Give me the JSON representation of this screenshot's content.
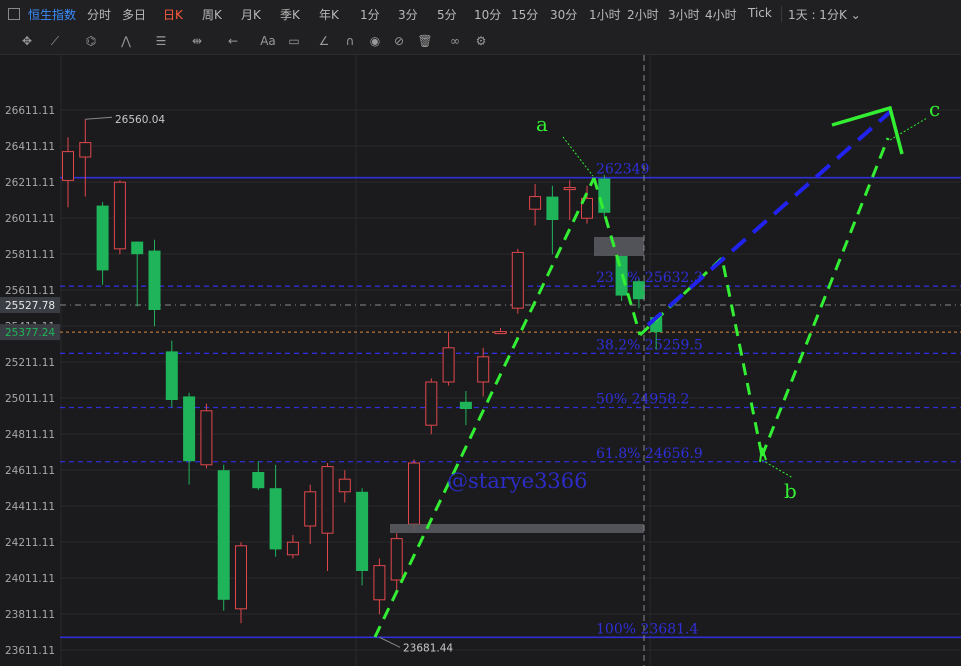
{
  "toolbar": {
    "index_tag": "恒生指数",
    "periods": [
      "分时",
      "多日",
      "日K",
      "周K",
      "月K",
      "季K",
      "年K",
      "1分",
      "3分",
      "5分",
      "10分",
      "15分",
      "30分",
      "1小时",
      "2小时",
      "3小时",
      "4小时",
      "Tick"
    ],
    "active_period": "日K",
    "range_select": "1天 : 1分K"
  },
  "tools": [
    "crosshair-icon",
    "line-tool-icon",
    "pattern-icon",
    "wave-tool-icon",
    "fib-tool-icon",
    "measure-tool-icon",
    "arrow-tool-icon",
    "text-tool-icon",
    "comment-tool-icon",
    "ruler-icon",
    "magnet-icon",
    "eye-icon",
    "hide-icon",
    "trash-icon",
    "link-icon",
    "settings-icon"
  ],
  "tool_glyphs": [
    "✥",
    "⟋",
    "⌬",
    "⋀",
    "☰",
    "⇹",
    "←",
    "Aa",
    "▭",
    "∠",
    "∩",
    "◉",
    "⊘",
    "🗑",
    "∞",
    "⚙"
  ],
  "colors": {
    "up": "#e0474c",
    "down": "#1fb45a",
    "fib": "#2f2fd8",
    "projection_green": "#33ee33",
    "projection_blue": "#2222ee",
    "price_tag_dark": "#3a3d43"
  },
  "chart_data": {
    "type": "candlestick",
    "y_ticks": [
      "26611.11",
      "26411.11",
      "26211.11",
      "26011.11",
      "25811.11",
      "25611.11",
      "25411.11",
      "25211.11",
      "25011.11",
      "24811.11",
      "24611.11",
      "24411.11",
      "24211.11",
      "24011.11",
      "23811.11",
      "23611.11"
    ],
    "ylim": [
      23580,
      26880
    ],
    "current_price": "25527.78",
    "last_price": "25377.24",
    "high_label": "26560.04",
    "low_label": "23681.44",
    "fib_levels": [
      {
        "label": "262349",
        "value": 26234.9
      },
      {
        "label": "23.6% 25632.3",
        "value": 25632.3
      },
      {
        "label": "38.2% 25259.5",
        "value": 25259.5
      },
      {
        "label": "50% 24958.2",
        "value": 24958.2
      },
      {
        "label": "61.8% 24656.9",
        "value": 24656.9
      },
      {
        "label": "100% 23681.4",
        "value": 23681.4
      }
    ],
    "wave_labels": [
      "a",
      "b",
      "c"
    ],
    "watermark": "@starye3366",
    "candles": [
      {
        "o": 26220,
        "h": 26460,
        "l": 26070,
        "c": 26380
      },
      {
        "o": 26350,
        "h": 26560.04,
        "l": 26130,
        "c": 26430
      },
      {
        "o": 26080,
        "h": 26100,
        "l": 25640,
        "c": 25720
      },
      {
        "o": 25840,
        "h": 26220,
        "l": 25810,
        "c": 26210
      },
      {
        "o": 25880,
        "h": 25880,
        "l": 25520,
        "c": 25810
      },
      {
        "o": 25830,
        "h": 25890,
        "l": 25410,
        "c": 25500
      },
      {
        "o": 25270,
        "h": 25330,
        "l": 24960,
        "c": 25000
      },
      {
        "o": 25020,
        "h": 25040,
        "l": 24530,
        "c": 24660
      },
      {
        "o": 24640,
        "h": 24980,
        "l": 24620,
        "c": 24940
      },
      {
        "o": 24610,
        "h": 24640,
        "l": 23830,
        "c": 23890
      },
      {
        "o": 23840,
        "h": 24210,
        "l": 23760,
        "c": 24190
      },
      {
        "o": 24600,
        "h": 24660,
        "l": 24500,
        "c": 24510
      },
      {
        "o": 24510,
        "h": 24640,
        "l": 24130,
        "c": 24170
      },
      {
        "o": 24140,
        "h": 24250,
        "l": 24120,
        "c": 24210
      },
      {
        "o": 24300,
        "h": 24530,
        "l": 24200,
        "c": 24490
      },
      {
        "o": 24260,
        "h": 24650,
        "l": 24050,
        "c": 24630
      },
      {
        "o": 24490,
        "h": 24610,
        "l": 24430,
        "c": 24560
      },
      {
        "o": 24490,
        "h": 24510,
        "l": 23970,
        "c": 24050
      },
      {
        "o": 23890,
        "h": 24120,
        "l": 23810,
        "c": 24080
      },
      {
        "o": 24000,
        "h": 24260,
        "l": 23930,
        "c": 24230
      },
      {
        "o": 24310,
        "h": 24670,
        "l": 24280,
        "c": 24650
      },
      {
        "o": 24860,
        "h": 25120,
        "l": 24810,
        "c": 25100
      },
      {
        "o": 25100,
        "h": 25380,
        "l": 25080,
        "c": 25290
      },
      {
        "o": 24990,
        "h": 25050,
        "l": 24860,
        "c": 24950
      },
      {
        "o": 25100,
        "h": 25290,
        "l": 25020,
        "c": 25240
      },
      {
        "o": 25380,
        "h": 25400,
        "l": 25370,
        "c": 25380
      },
      {
        "o": 25510,
        "h": 25840,
        "l": 25480,
        "c": 25820
      },
      {
        "o": 26060,
        "h": 26200,
        "l": 25970,
        "c": 26130
      },
      {
        "o": 26130,
        "h": 26190,
        "l": 25810,
        "c": 26000
      },
      {
        "o": 26180,
        "h": 26220,
        "l": 26000,
        "c": 26180
      },
      {
        "o": 26010,
        "h": 26190,
        "l": 25980,
        "c": 26120
      },
      {
        "o": 26230,
        "h": 26250,
        "l": 26020,
        "c": 26040
      },
      {
        "o": 25800,
        "h": 25810,
        "l": 25550,
        "c": 25580
      },
      {
        "o": 25660,
        "h": 25670,
        "l": 25510,
        "c": 25560
      },
      {
        "o": 25460,
        "h": 25470,
        "l": 25280,
        "c": 25377.24
      }
    ]
  }
}
